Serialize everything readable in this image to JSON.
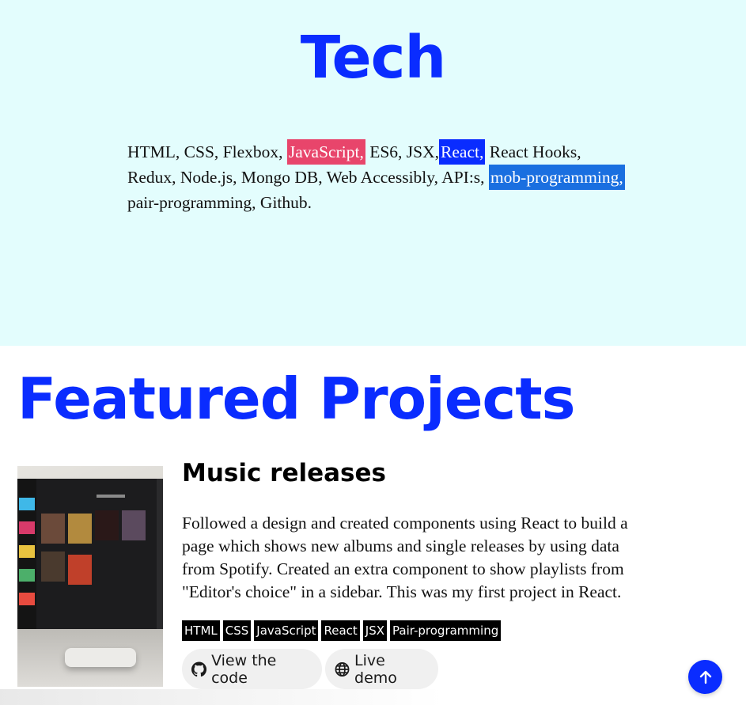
{
  "tech": {
    "title": "Tech",
    "seg1": "HTML, CSS, Flexbox, ",
    "hl1": "JavaScript,",
    "seg2": " ES6, JSX,",
    "hl2": "React,",
    "seg3": " React Hooks, Redux, Node.js, Mongo DB, Web Accessibly, API:s, ",
    "hl3": "mob-programming,",
    "seg4": " pair-programming, Github."
  },
  "featured": {
    "title": "Featured Projects"
  },
  "project": {
    "title": "Music releases",
    "description": "Followed a design and created components using React to build a page which shows new albums and single releases by using data from Spotify. Created an extra component to show playlists from \"Editor's choice\" in a sidebar. This was my first project in React.",
    "tags": [
      "HTML",
      "CSS",
      "JavaScript",
      "React",
      "JSX",
      "Pair-programming"
    ],
    "code_button": "View the code",
    "demo_button": "Live demo",
    "code_icon": "github-icon",
    "demo_icon": "globe-icon"
  },
  "scroll_top_icon": "arrow-up-icon",
  "colors": {
    "accent": "#0a2cff",
    "tech_bg": "#e3fdfd",
    "highlight_pink": "#e8456b",
    "highlight_mid": "#1a6fe0"
  }
}
